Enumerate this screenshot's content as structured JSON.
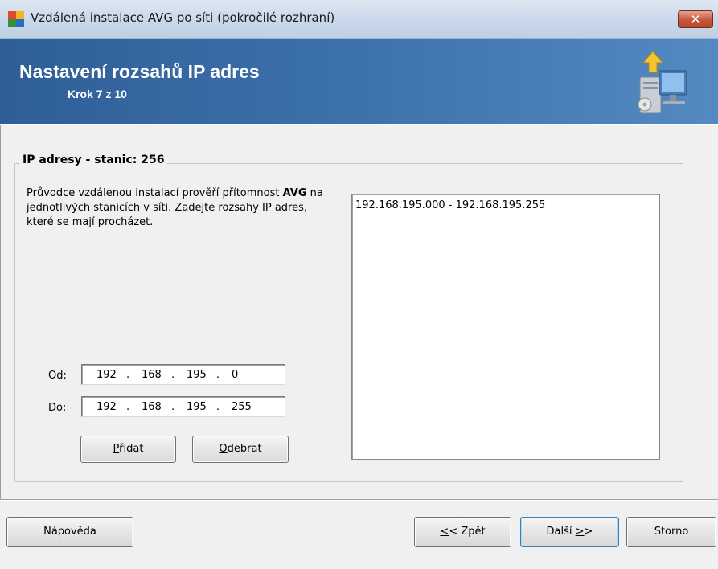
{
  "window": {
    "title": "Vzdálená instalace AVG po síti (pokročilé rozhraní)",
    "close_symbol": "✕"
  },
  "header": {
    "title": "Nastavení rozsahů IP adres",
    "step": "Krok 7 z 10",
    "icon": "install-computer-icon"
  },
  "group": {
    "legend": "IP adresy - stanic: 256",
    "description_before": "Průvodce vzdálenou instalací prověří přítomnost ",
    "description_bold": "AVG",
    "description_after": " na jednotlivých stanicích v síti. Zadejte rozsahy IP adres, které se mají procházet."
  },
  "from": {
    "label": "Od:",
    "octets": [
      "192",
      "168",
      "195",
      "0"
    ]
  },
  "to": {
    "label": "Do:",
    "octets": [
      "192",
      "168",
      "195",
      "255"
    ]
  },
  "ip_dot": ".",
  "add_button": {
    "before": "",
    "underlined": "P",
    "after": "řidat"
  },
  "remove_button": {
    "before": "",
    "underlined": "O",
    "after": "debrat"
  },
  "ranges": [
    "192.168.195.000 - 192.168.195.255"
  ],
  "footer": {
    "help": "Nápověda",
    "back": {
      "before": "",
      "underlined": "<",
      "after": "< Zpět"
    },
    "next": {
      "before": "Další ",
      "underlined": ">",
      "after": ">"
    },
    "cancel": "Storno"
  },
  "colors": {
    "banner_start": "#2f5e97",
    "banner_end": "#5489c2",
    "close_button": "#c6563c"
  }
}
